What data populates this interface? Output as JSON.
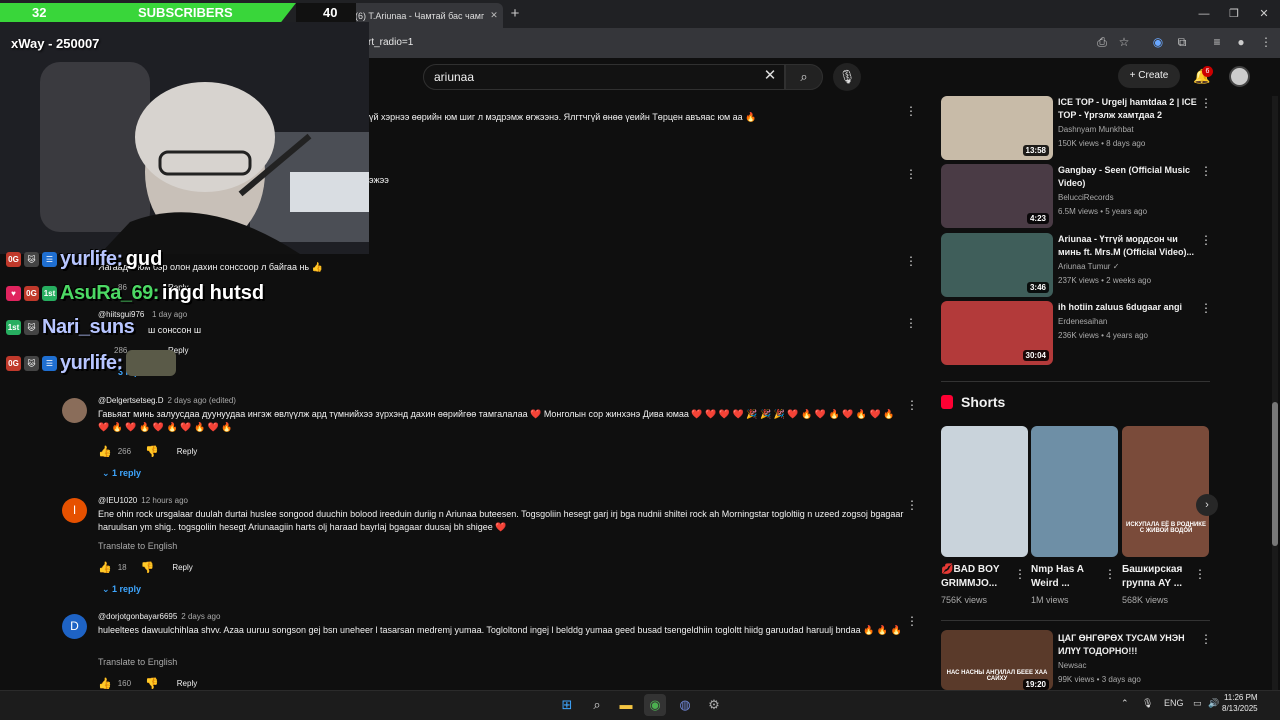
{
  "browser": {
    "tab_title": "(6) T.Ariunaa - Чамтай бас чамг",
    "url_text": "rt_radio=1",
    "new_tab": "+",
    "minimize": "—",
    "restore": "❐",
    "close": "✕"
  },
  "youtube": {
    "search_value": "ariunaa",
    "create_label": "Create",
    "notifications": "6"
  },
  "overlay": {
    "subs_count": "32",
    "subs_label": "SUBSCRIBERS",
    "subs_goal": "40",
    "cam_text": "xWay - 250007",
    "chat": [
      {
        "badges": [
          "0G",
          "🐱",
          "☰"
        ],
        "user": "yurlife:",
        "message": "gud"
      },
      {
        "badges": [
          "♥",
          "0G",
          "1st"
        ],
        "user": "AsuRa_69:",
        "message": "ingd hutsd"
      },
      {
        "badges": [
          "1st",
          "🐱"
        ],
        "user": "Nari_suns",
        "message": ""
      },
      {
        "badges": [
          "0G",
          "🐱",
          "☰"
        ],
        "user": "yurlife:",
        "message": ""
      }
    ]
  },
  "partial_comments": {
    "line1": "үй хэрнээ өөрийн юм шиг л мэдрэмж өгжээнэ. Ялгтчгүй өнөө үеийн Төрцен авъяас юм аа 🔥",
    "line2": "эжээ",
    "line3": "Яагаад ч юм бэр олон дахин сонссоор л байгаа нь 👍",
    "line3_likes": "86",
    "line3_reply": "Reply",
    "user4": "@hiitsgui976",
    "date4": "1 day ago",
    "line4": "ш сонссон ш",
    "likes4": "286",
    "reply4": "Reply",
    "replies4": "3 replies"
  },
  "comments": [
    {
      "avatar": "",
      "author": "@Delgertsetseg.D",
      "date": "2 days ago (edited)",
      "text": "Гавьяат минь залуусдаа дуунуудаа ингэж өвлүүлж ард түмнийхээ зүрхэнд дахин өөрийгөө тамгалалаа ❤️ Монголын сор жинхэнэ Дива юмаа ❤️ ❤️ ❤️ ❤️ 🎉 🎉 🎉 ❤️ 🔥 ❤️ 🔥 ❤️ 🔥 ❤️ 🔥 ❤️ 🔥 ❤️ 🔥 ❤️ 🔥 ❤️ 🔥 ❤️ 🔥",
      "translate": "",
      "likes": "266",
      "reply": "Reply",
      "replies": "1 reply",
      "avatar_color": "#8a6d5a"
    },
    {
      "avatar": "I",
      "author": "@IEU1020",
      "date": "12 hours ago",
      "text": "Ene ohin rock ursgalaar duulah durtai huslee songood duuchin bolood ireeduin duriig n Ariunaa buteesen. Togsgoliin hesegt garj irj bga nudnii shiltei rock ah Morningstar togloltiig n uzeed zogsoj bgagaar haruulsan ym shig.. togsgoliin hesegt Ariunaagiin harts olj haraad bayrlaj bgagaar duusaj bh shigee ❤️",
      "translate": "Translate to English",
      "likes": "18",
      "reply": "Reply",
      "replies": "1 reply",
      "avatar_color": "#e65100"
    },
    {
      "avatar": "D",
      "author": "@dorjotgonbayar6695",
      "date": "2 days ago",
      "text": "huleeltees dawuulchihlaa shvv. Azaa uuruu songson gej bsn uneheer l tasarsan medremj yumaa. Togloltond ingej l belddg yumaa geed busad tsengeldhiin togloltt hiidg garuudad haruulj bndaa 🔥 🔥 🔥",
      "translate": "Translate to English",
      "likes": "160",
      "reply": "Reply",
      "replies": "",
      "avatar_color": "#1e63c5"
    }
  ],
  "sidebar": {
    "videos": [
      {
        "title": "ICE TOP - Urgelj hamtdaa 2 | ICE TOP - Үргэлж хамтдаа 2",
        "channel": "Dashnyam Munkhbat",
        "meta": "150K views • 8 days ago",
        "duration": "13:58",
        "verified": "",
        "thumb": "#c8bba8"
      },
      {
        "title": "Gangbay - Seen (Official Music Video)",
        "channel": "BelucciRecords",
        "meta": "6.5M views • 5 years ago",
        "duration": "4:23",
        "verified": "",
        "thumb": "#4a3b45"
      },
      {
        "title": "Ariunaa - Үтгүй мордсон чи минь ft. Mrs.M (Official Video)...",
        "channel": "Ariunaa Tumur",
        "meta": "237K views • 2 weeks ago",
        "duration": "3:46",
        "verified": "✓",
        "thumb": "#3f5e5a"
      },
      {
        "title": "ih hotiin zaluus 6dugaar angi",
        "channel": "Erdenesaihan",
        "meta": "236K views • 4 years ago",
        "duration": "30:04",
        "verified": "",
        "thumb": "#b33a3a"
      }
    ],
    "shorts_heading": "Shorts",
    "shorts": [
      {
        "title": "💋BAD BOY GRIMMJO...",
        "views": "756K views",
        "thumb": "#c9d3db"
      },
      {
        "title": "Nmp Has A Weird ...",
        "views": "1M views",
        "thumb": "#6e8fa6"
      },
      {
        "title": "Башкирская группа AY ...",
        "views": "568K views",
        "thumb": "#7a4b3a",
        "overlay": "ИСКУПАЛА ЕЁ В РОДНИКЕ С ЖИВОЙ ВОДОЙ"
      }
    ],
    "bottom_video": {
      "title": "ЦАГ ӨНГӨРӨХ ТУСАМ УНЭН ИЛҮҮ ТОДОРНО!!!",
      "channel": "Newsac",
      "meta": "99K views • 3 days ago",
      "duration": "19:20",
      "thumb_text": "НАС НАСНЫ АНГИЛАЛ БЕЕЕ ХАА САЙХУ",
      "thumb": "#5a3a2a"
    }
  },
  "taskbar": {
    "time": "11:26 PM",
    "date": "8/13/2025",
    "lang": "ENG"
  }
}
